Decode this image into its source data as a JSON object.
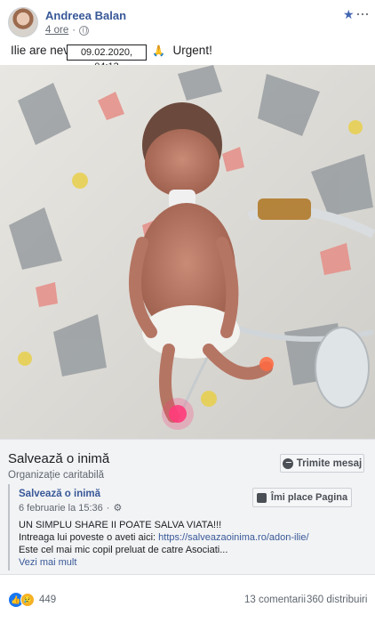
{
  "post": {
    "author": "Andreea Balan",
    "time_ago": "4 ore",
    "timestamp_tooltip": "09.02.2020, 04:13",
    "text_start": "Ilie are nevo",
    "text_end": "Urgent!",
    "emoji_icon": "folded-hands-icon"
  },
  "link_card": {
    "page_name": "Salvează o inimă",
    "page_category": "Organizație caritabilă",
    "message_button": "Trimite mesaj",
    "shared": {
      "page_name": "Salvează o inimă",
      "date": "6 februarie la 15:36",
      "like_page_button": "Îmi place Pagina",
      "line1": "UN SIMPLU SHARE II POATE SALVA VIATA!!!",
      "line2_text": "Intreaga lui poveste o aveti aici: ",
      "line2_link": "https://salveazaoinima.ro/adon-ilie/",
      "line3": "Este cel mai mic copil preluat de catre Asociati...",
      "see_more": "Vezi mai mult"
    }
  },
  "footer": {
    "reaction_count": "449",
    "comments": "13 comentarii",
    "shares": "360 distribuiri"
  },
  "colors": {
    "link": "#385898",
    "like_blue": "#1877f2",
    "sad_yellow": "#f7b125"
  }
}
